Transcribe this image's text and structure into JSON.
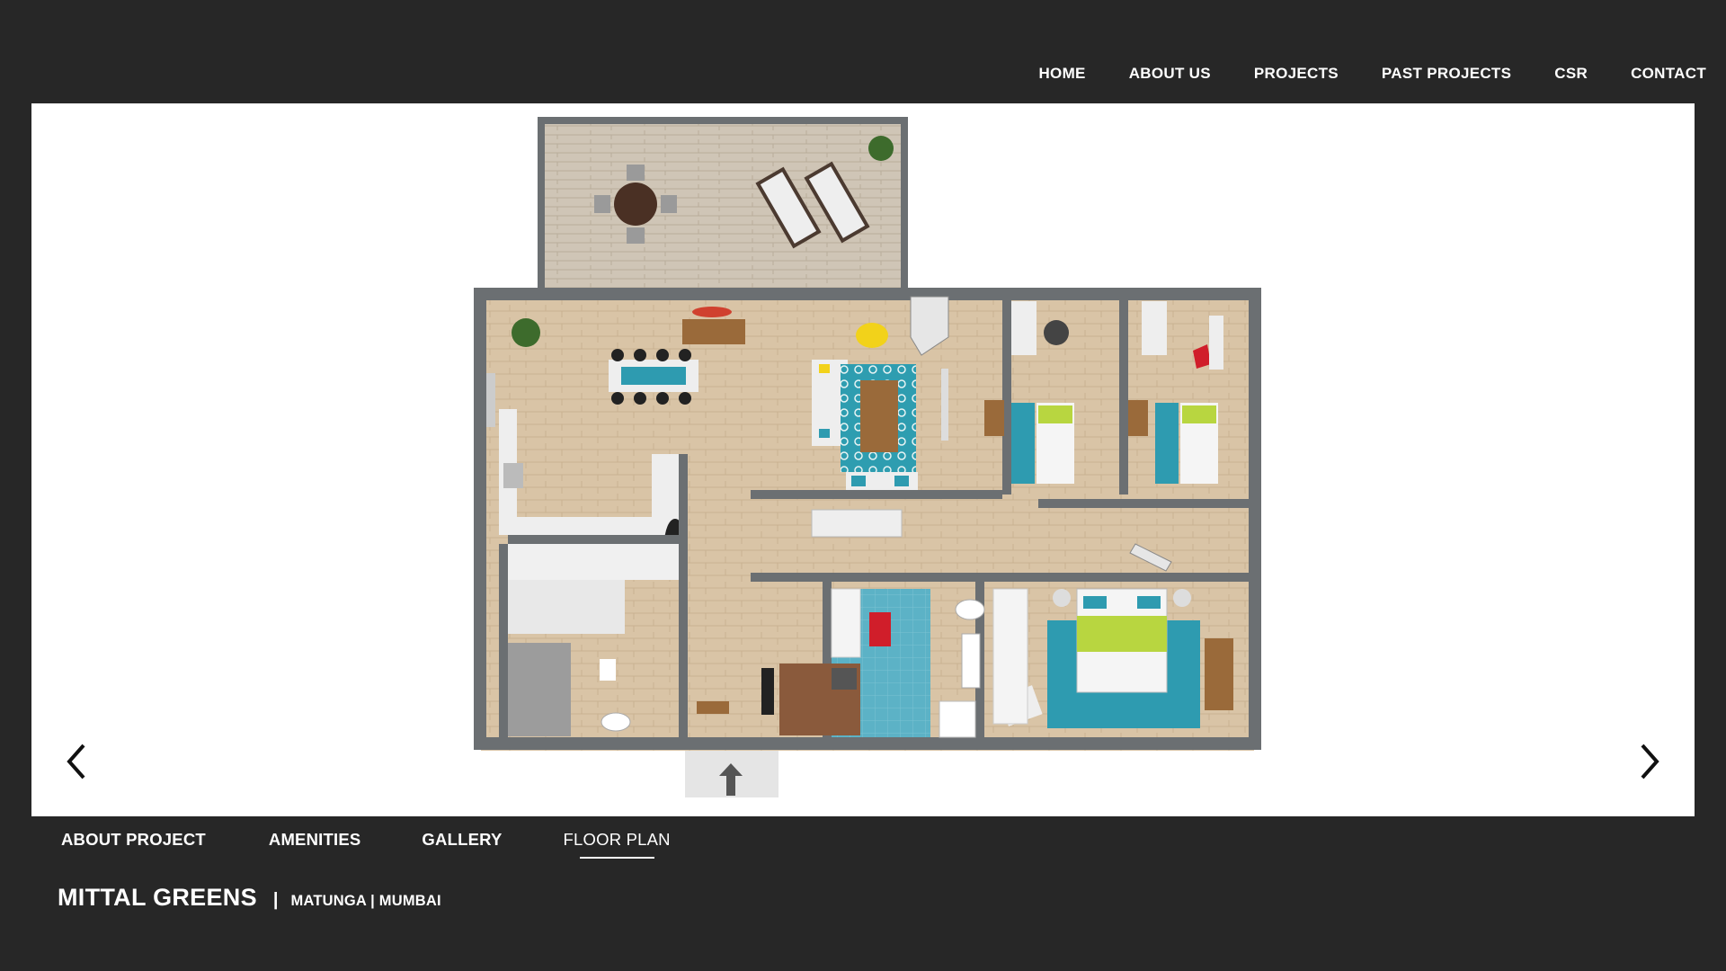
{
  "nav": {
    "items": [
      "HOME",
      "ABOUT US",
      "PROJECTS",
      "PAST PROJECTS",
      "CSR",
      "CONTACT"
    ]
  },
  "slider": {
    "prev_icon": "chevron-left-icon",
    "next_icon": "chevron-right-icon"
  },
  "subnav": {
    "tabs": [
      "ABOUT PROJECT",
      "AMENITIES",
      "GALLERY",
      "FLOOR PLAN"
    ],
    "active": "FLOOR PLAN"
  },
  "project": {
    "name": "MITTAL GREENS",
    "separator": "|",
    "location": "MATUNGA | MUMBAI"
  },
  "colors": {
    "background": "#272727",
    "panel": "#ffffff",
    "floor_wood": "#d8c3a5",
    "rug_teal": "#2e9bb0",
    "bathroom_tile": "#5ab4c8",
    "wall": "#6b6f72"
  }
}
